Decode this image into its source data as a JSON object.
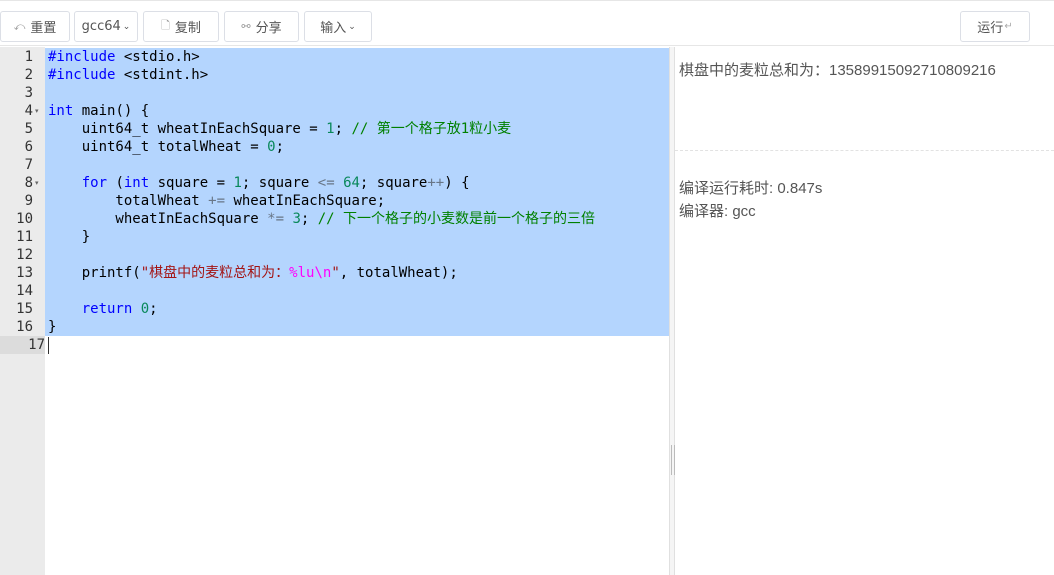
{
  "toolbar": {
    "reset": {
      "icon": "undo-icon",
      "glyph": "⤺",
      "label": "重置"
    },
    "compiler_select": {
      "value": "gcc64",
      "caret": "⌄"
    },
    "copy": {
      "icon": "copy-icon",
      "glyph": "🗋",
      "label": "复制"
    },
    "share": {
      "icon": "link-icon",
      "glyph": "⚯",
      "label": "分享"
    },
    "input": {
      "label": "输入",
      "caret": "⌄"
    },
    "run": {
      "label": "运行",
      "enter_glyph": "↵"
    }
  },
  "editor": {
    "fold_glyph": "▾",
    "line_numbers": [
      "1",
      "2",
      "3",
      "4",
      "5",
      "6",
      "7",
      "8",
      "9",
      "10",
      "11",
      "12",
      "13",
      "14",
      "15",
      "16",
      "17"
    ]
  },
  "output": {
    "result": "棋盘中的麦粒总和为：13589915092710809216",
    "time": "编译运行耗时: 0.847s",
    "compiler": "编译器: gcc"
  },
  "colors": {
    "selection": "#b4d5fe",
    "keyword": "#0000ff",
    "number": "#09885a",
    "comment": "#008000",
    "string": "#a31515"
  }
}
